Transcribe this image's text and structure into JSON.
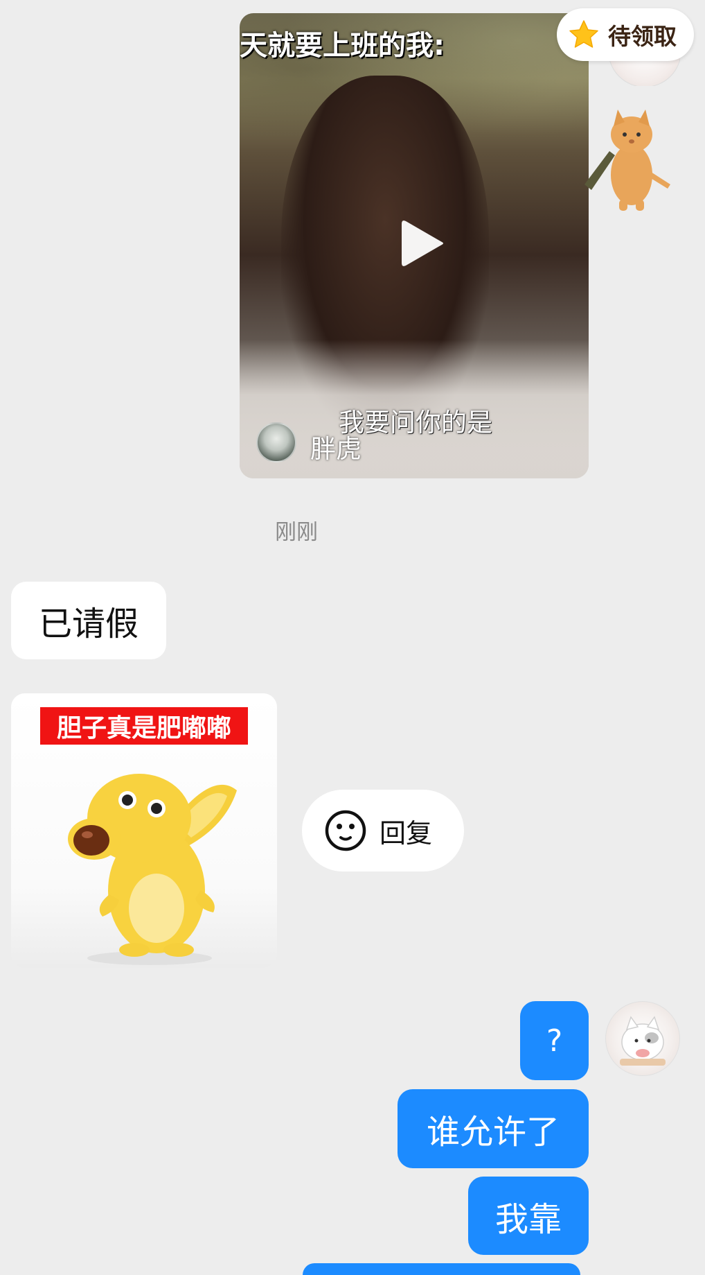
{
  "floating_badge": {
    "label": "待领取",
    "icon": "star-icon"
  },
  "video_message": {
    "top_caption": "天就要上班的我:",
    "subtitle": "我要问你的是",
    "author_name": "胖虎",
    "play_icon": "play-icon"
  },
  "timestamp": "刚刚",
  "incoming_messages": [
    {
      "type": "text",
      "text": "已请假"
    },
    {
      "type": "sticker",
      "caption": "胆子真是肥嘟嘟"
    }
  ],
  "reply_button": {
    "label": "回复",
    "icon": "smile-icon"
  },
  "outgoing_messages": [
    {
      "type": "text",
      "text": "?"
    },
    {
      "type": "text",
      "text": "谁允许了"
    },
    {
      "type": "text",
      "text": "我靠"
    }
  ],
  "colors": {
    "background": "#EDEDED",
    "outgoing_bubble": "#1C8BFF",
    "incoming_bubble": "#FFFFFF",
    "timestamp_text": "#8A8A8A",
    "sticker_banner": "#F01414"
  }
}
